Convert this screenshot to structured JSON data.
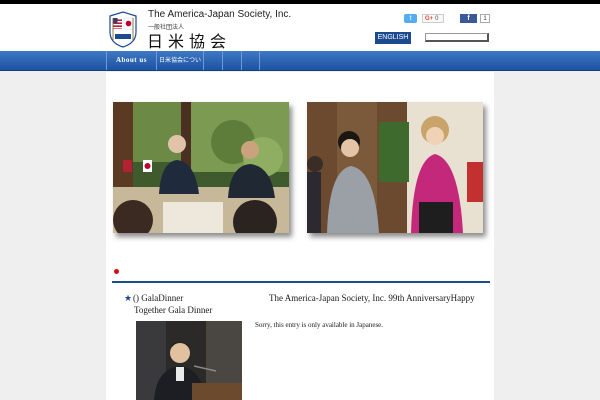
{
  "header": {
    "title_en": "The America-Japan Society, Inc.",
    "title_jp_small": "一般社団法人",
    "title_jp": "日米協会",
    "english_label": "ENGLISH",
    "search_placeholder": ""
  },
  "social": {
    "tweet_label": "t",
    "gplus_label": "G+",
    "gplus_count": "0",
    "fb_label": "f",
    "fb_count": "1"
  },
  "nav": {
    "items": [
      {
        "label": "About us"
      },
      {
        "label": "日米協会について"
      },
      {
        "label": ""
      },
      {
        "label": ""
      },
      {
        "label": ""
      }
    ]
  },
  "entry": {
    "title_line1": "() GalaDinner",
    "title_line2": "Together Gala Dinner",
    "heading": "The America-Japan Society, Inc. 99th AnniversaryHappy",
    "note": "Sorry, this entry is only available in Japanese."
  },
  "icons": {
    "star": "star-icon",
    "bullet": "red-dot-icon"
  },
  "colors": {
    "nav_blue": "#1d52a3",
    "accent_blue": "#1b4a8f",
    "bullet_red": "#d01010"
  }
}
